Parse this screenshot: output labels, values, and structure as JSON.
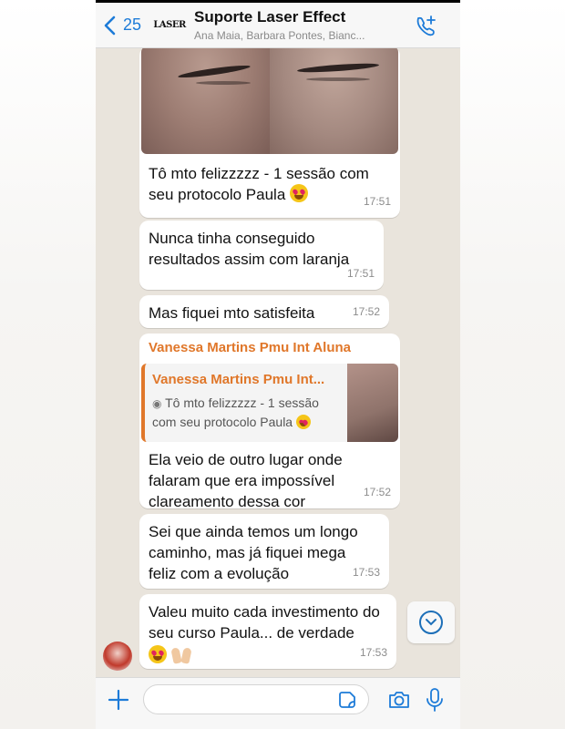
{
  "header": {
    "back_count": "25",
    "logo_text": "LASER",
    "title": "Suporte Laser Effect",
    "members": "Ana Maia, Barbara Pontes, Bianc..."
  },
  "messages": [
    {
      "text": "Tô mto felizzzzz - 1 sessão com seu protocolo Paula",
      "time": "17:51"
    },
    {
      "text": "Nunca tinha conseguido resultados assim com laranja",
      "time": "17:51"
    },
    {
      "text": "Mas fiquei mto satisfeita",
      "time": "17:52"
    },
    {
      "sender": "Vanessa Martins Pmu Int Aluna",
      "quote_name": "Vanessa Martins Pmu Int...",
      "quote_text": "Tô mto felizzzzz - 1 sessão com seu protocolo Paula",
      "text": "Ela veio de outro lugar onde falaram que era impossível clareamento dessa cor",
      "time": "17:52"
    },
    {
      "text": "Sei que ainda temos um longo caminho, mas já fiquei mega feliz com a evolução",
      "time": "17:53"
    },
    {
      "text": "Valeu muito cada investimento do seu curso Paula... de verdade",
      "time": "17:53"
    }
  ],
  "composer": {
    "placeholder": ""
  },
  "colors": {
    "accent": "#1d7bd8",
    "sender": "#e0772a",
    "bubble": "#ffffff",
    "chat_bg": "#e9e4dc"
  },
  "icons": [
    "chevron-left-icon",
    "add-call-icon",
    "plus-icon",
    "sticker-icon",
    "camera-icon",
    "microphone-icon",
    "chevron-down-icon"
  ]
}
